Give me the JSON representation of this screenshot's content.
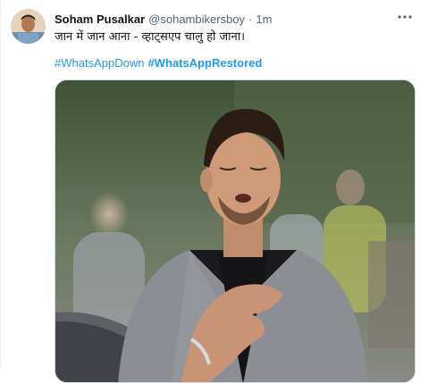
{
  "tweet": {
    "author_name": "Soham Pusalkar",
    "author_handle": "@sohambikersboy",
    "separator": "·",
    "time": "1m",
    "more_icon": "more-horizontal-icon",
    "text": "जान में जान आना - व्हाट्सएप चालु हो जाना।",
    "hashtags": [
      {
        "label": "#WhatsAppDown",
        "bold": false
      },
      {
        "label": "#WhatsAppRestored",
        "bold": true
      }
    ],
    "media_subject": "relieved-man-photo"
  },
  "colors": {
    "link": "#1d9bf0",
    "text_primary": "#0f1419",
    "text_secondary": "#536471",
    "border": "#cfd9de"
  }
}
